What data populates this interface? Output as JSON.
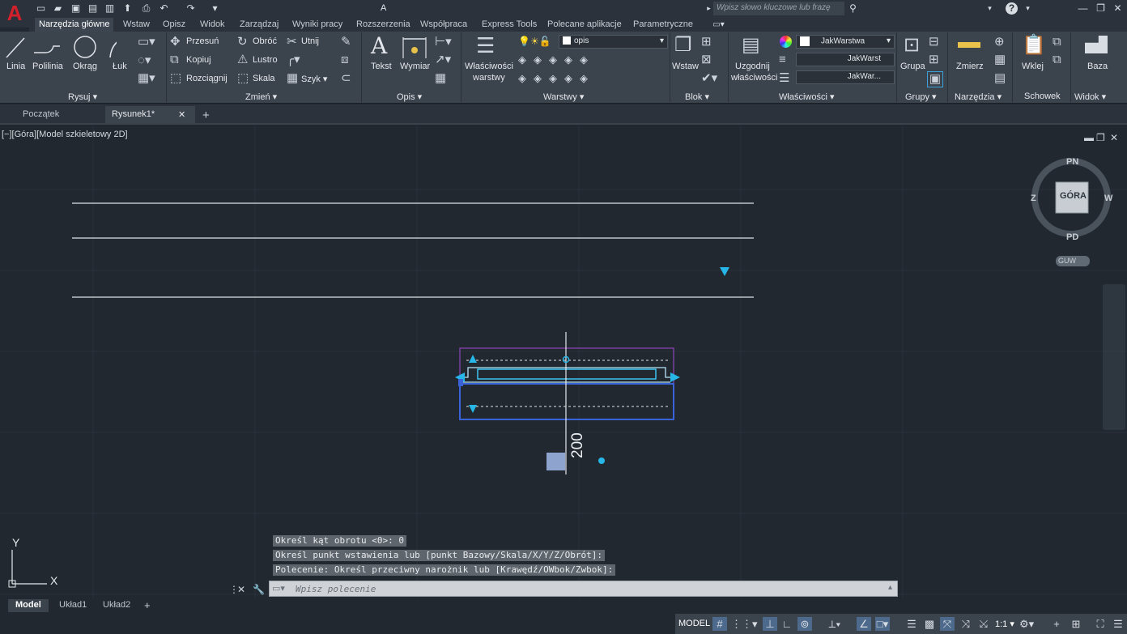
{
  "app": {
    "title": "A",
    "logo": "A"
  },
  "search": {
    "placeholder": "Wpisz słowo kluczowe lub frazę"
  },
  "ribbon_tabs": [
    "Narzędzia główne",
    "Wstaw",
    "Opisz",
    "Widok",
    "Zarządzaj",
    "Wyniki pracy",
    "Rozszerzenia",
    "Współpraca",
    "Express Tools",
    "Polecane aplikacje",
    "Parametryczne"
  ],
  "rysuj": {
    "linia": "Linia",
    "polilinia": "Polilinia",
    "okrag": "Okrąg",
    "luk": "Łuk",
    "panel": "Rysuj"
  },
  "zmien": {
    "przesun": "Przesuń",
    "obroc": "Obróć",
    "utnij": "Utnij",
    "kopiuj": "Kopiuj",
    "lustro": "Lustro",
    "rozciagnij": "Rozciągnij",
    "skala": "Skala",
    "szyk": "Szyk",
    "panel": "Zmień"
  },
  "opis": {
    "tekst": "Tekst",
    "wymiar": "Wymiar",
    "panel": "Opis"
  },
  "warstwy": {
    "wlasciwosci": "Właściwości",
    "warstwy": "warstwy",
    "layer": "opis",
    "panel": "Warstwy"
  },
  "blok": {
    "wstaw": "Wstaw",
    "panel": "Blok"
  },
  "wlasciwosci": {
    "uzgodnij": "Uzgodnij",
    "wlasciwosci": "właściwości",
    "color": "JakWarstwa",
    "linetype": "JakWarst",
    "lineweight": "JakWar...",
    "panel": "Właściwości"
  },
  "grupy": {
    "grupa": "Grupa",
    "panel": "Grupy"
  },
  "narzedzia": {
    "zmierz": "Zmierz",
    "panel": "Narzędzia"
  },
  "schowek": {
    "wklej": "Wklej",
    "panel": "Schowek"
  },
  "widok": {
    "baza": "Baza",
    "panel": "Widok"
  },
  "doc_tabs": {
    "start": "Początek",
    "drawing": "Rysunek1*"
  },
  "viewport": {
    "label": "[−][Góra][Model szkieletowy 2D]",
    "dimension": "200"
  },
  "viewcube": {
    "top": "GÓRA",
    "n": "PN",
    "s": "PD",
    "w": "Z",
    "e": "W",
    "ucs": "GUW"
  },
  "ucs_axes": {
    "x": "X",
    "y": "Y"
  },
  "command": {
    "history": [
      "Określ kąt obrotu <0>: 0",
      "Określ punkt wstawienia lub [punkt Bazowy/Skala/X/Y/Z/Obrót]:",
      "Polecenie: Określ przeciwny narożnik lub [Krawędź/OWbok/Zwbok]:"
    ],
    "placeholder": "Wpisz polecenie"
  },
  "layout_tabs": [
    "Model",
    "Układ1",
    "Układ2"
  ],
  "status": {
    "model": "MODEL",
    "scale": "1:1"
  }
}
